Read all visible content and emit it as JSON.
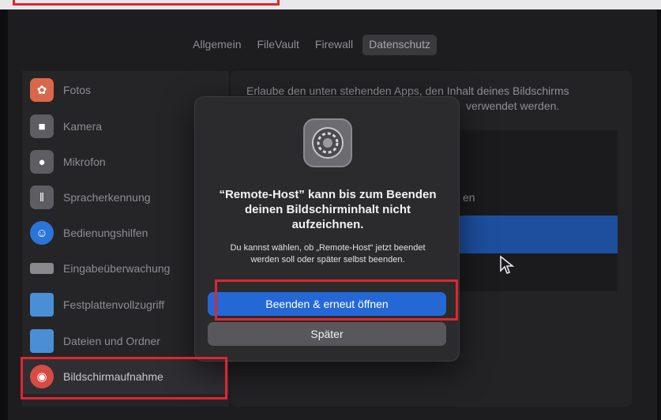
{
  "tabs": [
    {
      "label": "Allgemein",
      "active": false
    },
    {
      "label": "FileVault",
      "active": false
    },
    {
      "label": "Firewall",
      "active": false
    },
    {
      "label": "Datenschutz",
      "active": true
    }
  ],
  "sidebar": {
    "items": [
      {
        "label": "Fotos",
        "icon": "photos-icon",
        "color": "#d9674c"
      },
      {
        "label": "Kamera",
        "icon": "camera-icon",
        "color": "#5e5e62"
      },
      {
        "label": "Mikrofon",
        "icon": "microphone-icon",
        "color": "#5e5e62"
      },
      {
        "label": "Spracherkennung",
        "icon": "waveform-icon",
        "color": "#5e5e62"
      },
      {
        "label": "Bedienungshilfen",
        "icon": "accessibility-icon",
        "color": "#2b74d8"
      },
      {
        "label": "Eingabeüberwachung",
        "icon": "keyboard-icon",
        "color": "#8a8a8e"
      },
      {
        "label": "Festplattenvollzugriff",
        "icon": "folder-icon",
        "color": "#4a8fd6"
      },
      {
        "label": "Dateien und Ordner",
        "icon": "folder-icon",
        "color": "#4a8fd6"
      },
      {
        "label": "Bildschirmaufnahme",
        "icon": "screen-recording-icon",
        "color": "#d84b45",
        "selected": true
      }
    ]
  },
  "content": {
    "description": "Erlaube den unten stehenden Apps, den Inhalt deines Bildschirms",
    "description_line2": "verwendet werden.",
    "list_fragment": "en"
  },
  "dialog": {
    "icon": "system-preferences-gear-icon",
    "title": "“Remote-Host” kann bis zum Beenden deinen Bildschirminhalt nicht aufzeichnen.",
    "body": "Du kannst wählen, ob „Remote-Host“ jetzt beendet werden soll oder später selbst beenden.",
    "primary_button": "Beenden & erneut öffnen",
    "secondary_button": "Später"
  },
  "colors": {
    "accent": "#2468d6",
    "highlight": "#e1252d",
    "selection": "#1d4f9e"
  }
}
